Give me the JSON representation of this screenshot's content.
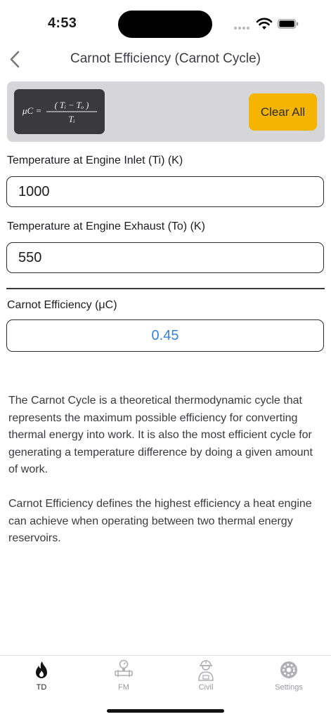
{
  "status": {
    "time": "4:53"
  },
  "nav": {
    "title": "Carnot Efficiency (Carnot Cycle)"
  },
  "toolbar": {
    "clear_label": "Clear All"
  },
  "formula": {
    "lhs": "μC =",
    "numerator": "( Tᵢ − Tₒ )",
    "denominator": "Tᵢ"
  },
  "form": {
    "inlet_label": "Temperature at Engine Inlet (Ti) (K)",
    "inlet_value": "1000",
    "exhaust_label": "Temperature at Engine Exhaust (To) (K)",
    "exhaust_value": "550",
    "result_label": "Carnot Efficiency (μC)",
    "result_value": "0.45"
  },
  "description": {
    "p1": "The Carnot Cycle is a theoretical thermodynamic cycle that represents the maximum possible efficiency for converting thermal energy into work. It is also the most efficient cycle for generating a temperature difference by doing a given amount of work.",
    "p2": "Carnot Efficiency defines the highest efficiency a heat engine can achieve when operating between two thermal energy reservoirs."
  },
  "tabs": [
    {
      "label": "TD",
      "icon": "flame-icon",
      "active": true
    },
    {
      "label": "FM",
      "icon": "pressure-gauge-icon",
      "active": false
    },
    {
      "label": "Civil",
      "icon": "worker-icon",
      "active": false
    },
    {
      "label": "Settings",
      "icon": "gear-icon",
      "active": false
    }
  ],
  "colors": {
    "accent": "#f4b400",
    "result": "#3a82d6",
    "formula_bg": "#3a3a3c",
    "bar_bg": "#d6d6d8"
  }
}
